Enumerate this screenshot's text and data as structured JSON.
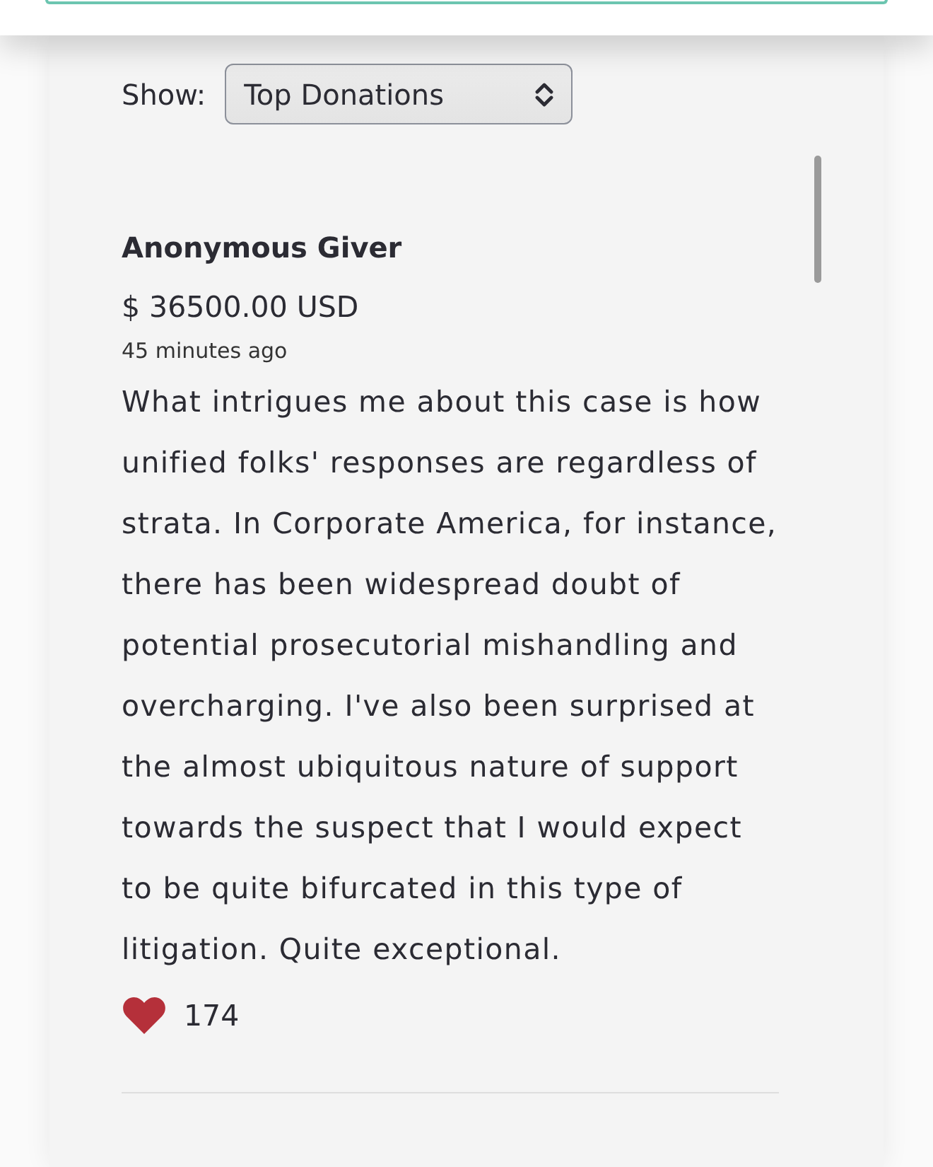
{
  "filter": {
    "label": "Show:",
    "value": "Top Donations"
  },
  "donations": [
    {
      "name": "Anonymous Giver",
      "amount": "$ 36500.00 USD",
      "time": "45 minutes ago",
      "message": "What intrigues me about this case is how unified folks' responses are regardless of strata. In Corporate America, for instance, there has been widespread doubt of potential prosecutorial mishandling and overcharging. I've also been surprised at the almost ubiquitous nature of support towards the suspect that I would expect to be quite bifurcated in this type of litigation. Quite exceptional.",
      "likes": "174"
    }
  ]
}
